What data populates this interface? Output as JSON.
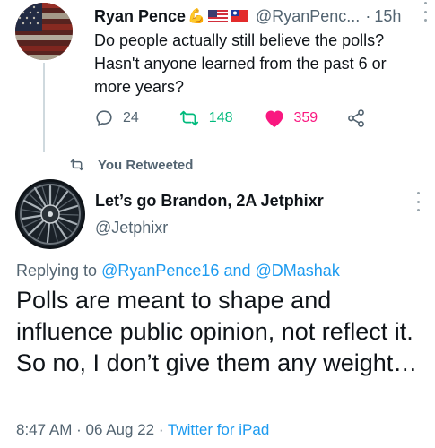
{
  "first_tweet": {
    "author_name": "Ryan Pence",
    "name_emoji": "💪",
    "flags": [
      "us-flag-icon",
      "taiwan-flag-icon"
    ],
    "handle": "@RyanPenc...",
    "separator": "·",
    "time": "15h",
    "text": "Do people actually still believe the polls? Hasn't anyone learned from the past 6 or more years?",
    "actions": {
      "reply_count": "24",
      "retweet_count": "148",
      "like_count": "359"
    }
  },
  "retweet_banner": {
    "label": "You Retweeted"
  },
  "second_tweet": {
    "author_name": "Let’s go Brandon, 2A Jetphixr",
    "handle": "@Jetphixr",
    "replying_prefix": "Replying to",
    "reply_handle_1": "@RyanPence16",
    "reply_and": "and",
    "reply_handle_2": "@DMashak",
    "text": "Polls are meant to shape and influence public opinion, not reflect it. So no, I don’t give them any weight…",
    "time": "8:47 AM",
    "date": "06 Aug 22",
    "meta_separator": "·",
    "source": "Twitter for iPad"
  },
  "colors": {
    "text_primary": "#0f1419",
    "text_secondary": "#536471",
    "link": "#1d9bf0",
    "retweet_green": "#00ba7c",
    "like_pink": "#f91880"
  }
}
